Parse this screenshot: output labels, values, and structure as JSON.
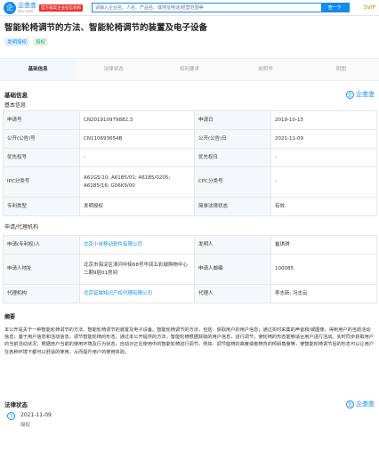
{
  "brand": {
    "name": "企查查",
    "domain": "Qcc.com",
    "tagline": "官方备案企业征信机构"
  },
  "search": {
    "placeholder": "请输入企业名、人名、产品名、或地址电话/经营范围等",
    "button": "查一下"
  },
  "svip": "SVIP",
  "title": "智能轮椅调节的方法、智能轮椅调节的装置及电子设备",
  "tags": [
    "发明授权",
    "授权"
  ],
  "tabs": [
    "基础信息",
    "法律状态",
    "权利要求",
    "说明书",
    "附图"
  ],
  "basic": {
    "heading": "基础信息",
    "sub": "基本信息",
    "rows": [
      {
        "k1": "申请号",
        "v1": "CN201910979882.3",
        "k2": "申请日",
        "v2": "2019-10-15"
      },
      {
        "k1": "公开(公告)号",
        "v1": "CN110693654B",
        "k2": "公开(公告)日",
        "v2": "2021-11-09"
      },
      {
        "k1": "优先权号",
        "v1": "-",
        "k2": "优先权日",
        "v2": "-"
      },
      {
        "k1": "IPC分类号",
        "v1": "A61G5/10; A61B5/01; A61B5/0205; A61B5/16; G06K9/00",
        "k2": "CPC分类号",
        "v2": "-"
      },
      {
        "k1": "专利类型",
        "v1": "发明授权",
        "k2": "简单法律状态",
        "v2": "有效"
      }
    ]
  },
  "applicant": {
    "sub": "申请/代理机构",
    "rows": [
      {
        "k1": "申请(专利权)人",
        "v1": "北京小米移动软件有限公司",
        "k2": "发明人",
        "v2": "崔琪琪"
      },
      {
        "k1": "申请人地址",
        "v1": "北京市海淀区清河中街68号华润五彩城购物中心二期9层01房间",
        "k2": "申请人邮编",
        "v2": "100085"
      },
      {
        "k1": "代理机构",
        "v1": "北京钲霖知识产权代理有限公司",
        "k2": "代理人",
        "v2": "李志新; 冯志云"
      }
    ]
  },
  "abstract": {
    "heading": "摘要",
    "text": "本公开是关于一种智能轮椅调节的方法、智能轮椅调节的装置及电子设备。智能轮椅调节的方法，包括：获取用户的用户信息；通过实时采集的声音和/或图像，得到用户的当前活动信息；基于用户信息和活动信息，调节智能轮椅的形态。通过本公开提供的方法，智能轮椅根据获取的用户信息，进行调节，使轮椅的形态能够适合用户进行活动。实时同步获取用户的当前活动状况，根据用户当前的使用环境及行为状态，自动对正在使用中的智能轮椅进行调节。例如：调节座椅的高度或者椅背的倾斜角度等，使智能轮椅调节后的形态可以让用户在各种环境下都可以舒适的使用，从而提升用户的使用体验。"
  },
  "legal": {
    "heading": "法律状态",
    "events": [
      {
        "num": "3",
        "date": "2021-11-09",
        "status": "授权"
      }
    ]
  },
  "qcc_logo": "企查查"
}
